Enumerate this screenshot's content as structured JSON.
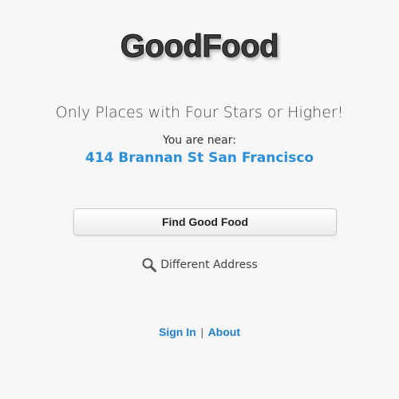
{
  "app": {
    "logo_text": "GoodFood"
  },
  "main": {
    "tagline": "Only Places with Four Stars or Higher!",
    "near_label": "You are near:",
    "address": "414 Brannan St San Francisco",
    "find_button_label": "Find Good Food",
    "different_address_label": "Different Address",
    "different_address_icon": "search-icon"
  },
  "footer": {
    "sign_in_label": "Sign In",
    "separator": "|",
    "about_label": "About"
  },
  "colors": {
    "link_blue": "#2a8fd6",
    "background": "#f6f6f6"
  }
}
